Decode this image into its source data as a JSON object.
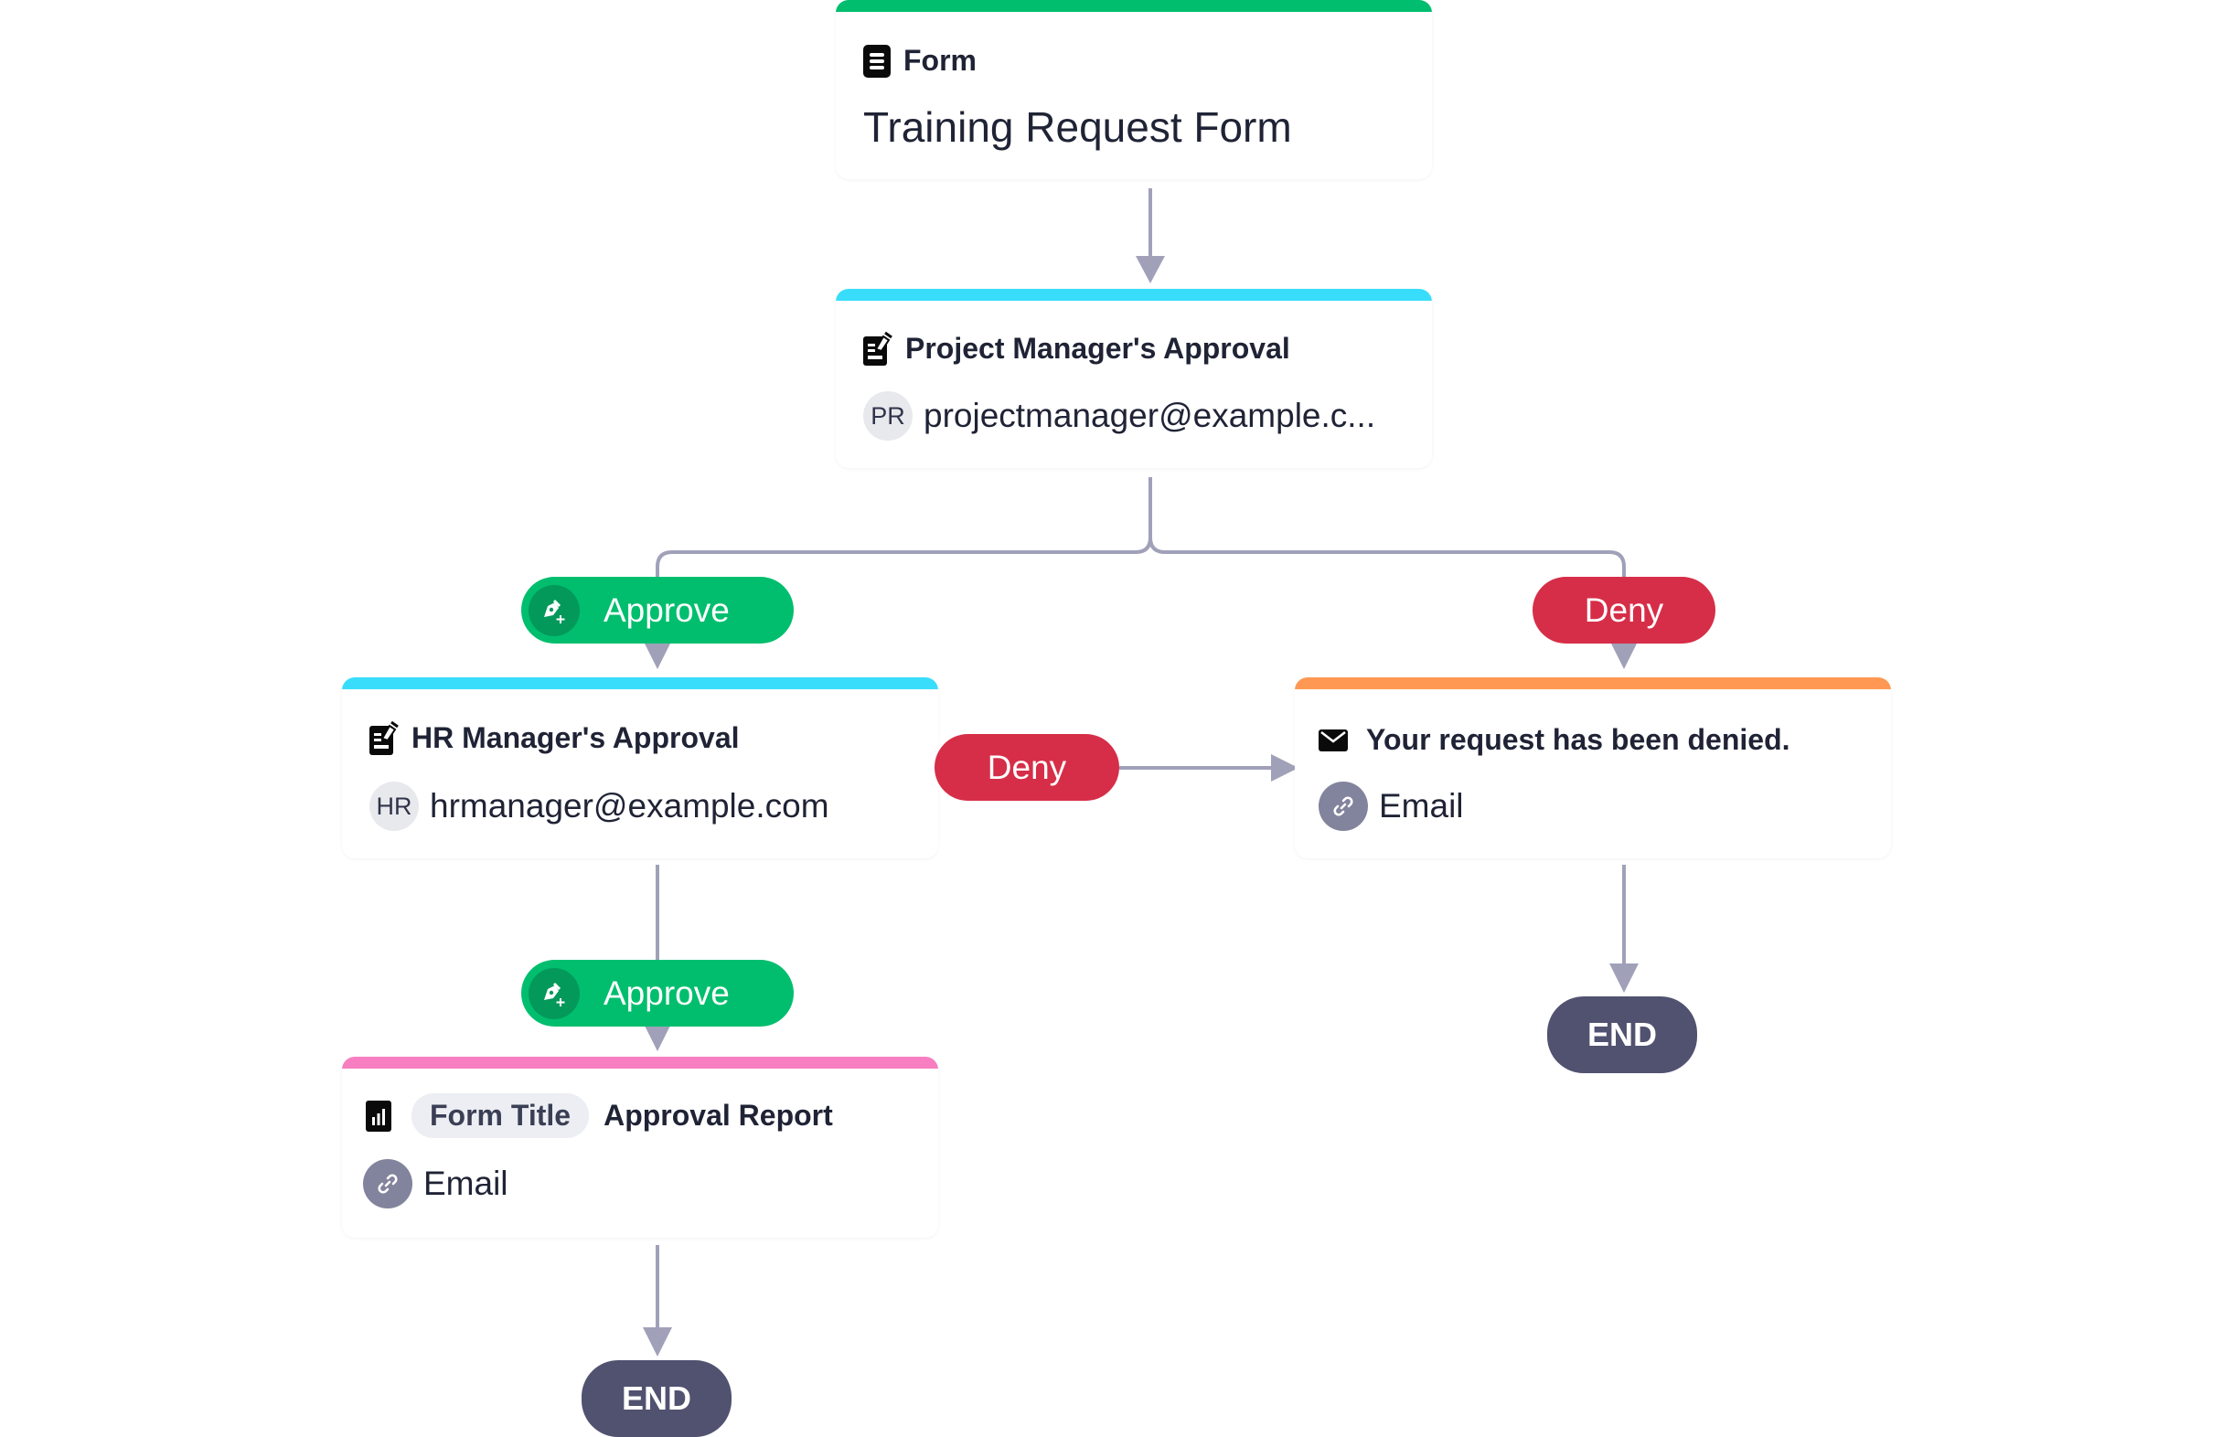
{
  "colors": {
    "form": "#00BE6E",
    "approval": "#38DDFB",
    "email": "#FF9852",
    "report": "#F77EC0",
    "approve": "#00BE6E",
    "deny": "#D62E48",
    "end": "#515170",
    "connector": "#A0A1B9"
  },
  "nodes": {
    "form": {
      "type_label": "Form",
      "icon": "form-icon",
      "title": "Training Request Form"
    },
    "pm_approval": {
      "title": "Project Manager's Approval",
      "icon": "approval-icon",
      "avatar": "PR",
      "assignee": "projectmanager@example.c..."
    },
    "hr_approval": {
      "title": "HR Manager's Approval",
      "icon": "approval-icon",
      "avatar": "HR",
      "assignee": "hrmanager@example.com"
    },
    "denied_email": {
      "title": "Your request has been denied.",
      "icon": "envelope-icon",
      "action_icon": "link-icon",
      "action": "Email"
    },
    "report": {
      "icon": "report-icon",
      "chip": "Form Title",
      "title": "Approval Report",
      "action_icon": "link-icon",
      "action": "Email"
    }
  },
  "branches": {
    "approve_1": "Approve",
    "deny_1": "Deny",
    "deny_2": "Deny",
    "approve_2": "Approve"
  },
  "ends": {
    "end_left": "END",
    "end_right": "END"
  }
}
